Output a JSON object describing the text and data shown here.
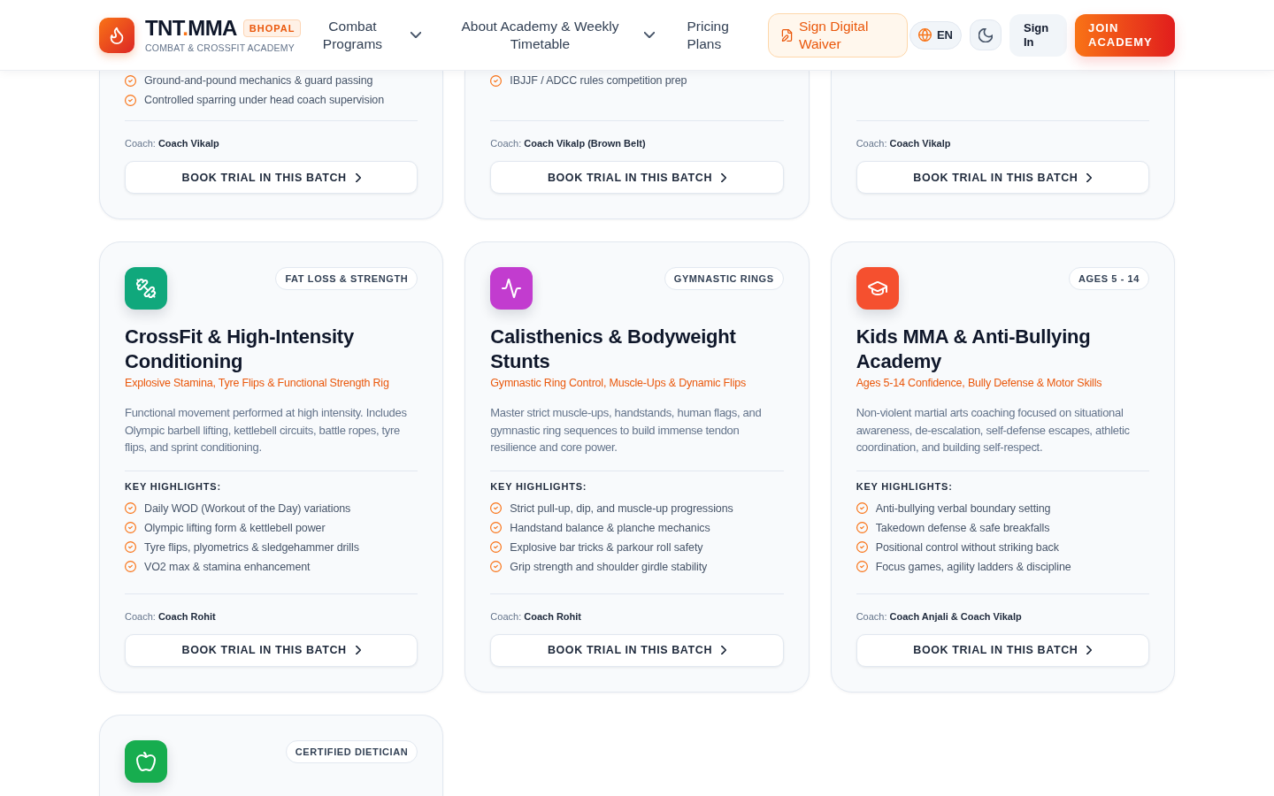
{
  "brand": {
    "name_start": "TNT",
    "separator": ".",
    "name_end": "MMA",
    "city": "BHOPAL",
    "tagline": "COMBAT & CROSSFIT ACADEMY"
  },
  "nav": [
    {
      "label": "Combat Programs",
      "dropdown": true
    },
    {
      "label": "About Academy & Weekly Timetable",
      "dropdown": true
    },
    {
      "label": "Pricing Plans",
      "dropdown": false
    }
  ],
  "actions": {
    "waiver_button": "Sign Digital Waiver",
    "language_button": "EN",
    "sign_in_button": "Sign In",
    "join_button": "JOIN ACADEMY"
  },
  "programs": [
    {
      "kind": "cut_top",
      "highlights": [
        "Ground-and-pound mechanics & guard passing",
        "Controlled sparring under head coach supervision"
      ],
      "coach_label": "Coach:",
      "coach": "Coach Vikalp",
      "button": "BOOK TRIAL IN THIS BATCH"
    },
    {
      "kind": "cut_top",
      "highlights": [
        "IBJJF / ADCC rules competition prep"
      ],
      "coach_label": "Coach:",
      "coach": "Coach Vikalp (Brown Belt)",
      "button": "BOOK TRIAL IN THIS BATCH"
    },
    {
      "kind": "cut_top",
      "coach_label": "Coach:",
      "coach": "Coach Vikalp",
      "button": "BOOK TRIAL IN THIS BATCH"
    },
    {
      "kind": "full",
      "color": "#10a87c",
      "badge": "FAT LOSS & STRENGTH",
      "title": "CrossFit & High-Intensity Conditioning",
      "subtitle": "Explosive Stamina, Tyre Flips & Functional Strength Rig",
      "description": "Functional movement performed at high intensity. Includes Olympic barbell lifting, kettlebell circuits, battle ropes, tyre flips, and sprint conditioning.",
      "highlights_heading": "KEY HIGHLIGHTS:",
      "highlights": [
        "Daily WOD (Workout of the Day) variations",
        "Olympic lifting form & kettlebell power",
        "Tyre flips, plyometrics & sledgehammer drills",
        "VO2 max & stamina enhancement"
      ],
      "coach_label": "Coach:",
      "coach": "Coach Rohit",
      "button": "BOOK TRIAL IN THIS BATCH"
    },
    {
      "kind": "full",
      "color": "#c23ccf",
      "badge": "GYMNASTIC RINGS",
      "title": "Calisthenics & Bodyweight Stunts",
      "subtitle": "Gymnastic Ring Control, Muscle-Ups & Dynamic Flips",
      "description": "Master strict muscle-ups, handstands, human flags, and gymnastic ring sequences to build immense tendon resilience and core power.",
      "highlights_heading": "KEY HIGHLIGHTS:",
      "highlights": [
        "Strict pull-up, dip, and muscle-up progressions",
        "Handstand balance & planche mechanics",
        "Explosive bar tricks & parkour roll safety",
        "Grip strength and shoulder girdle stability"
      ],
      "coach_label": "Coach:",
      "coach": "Coach Rohit",
      "button": "BOOK TRIAL IN THIS BATCH"
    },
    {
      "kind": "full",
      "color": "#f5502f",
      "badge": "AGES 5 - 14",
      "title": "Kids MMA & Anti-Bullying Academy",
      "subtitle": "Ages 5-14 Confidence, Bully Defense & Motor Skills",
      "description": "Non-violent martial arts coaching focused on situational awareness, de-escalation, self-defense escapes, athletic coordination, and building self-respect.",
      "highlights_heading": "KEY HIGHLIGHTS:",
      "highlights": [
        "Anti-bullying verbal boundary setting",
        "Takedown defense & safe breakfalls",
        "Positional control without striking back",
        "Focus games, agility ladders & discipline"
      ],
      "coach_label": "Coach:",
      "coach": "Coach Anjali & Coach Vikalp",
      "button": "BOOK TRIAL IN THIS BATCH"
    },
    {
      "kind": "cut_bottom",
      "color": "#17ad4f",
      "badge": "CERTIFIED DIETICIAN"
    }
  ]
}
